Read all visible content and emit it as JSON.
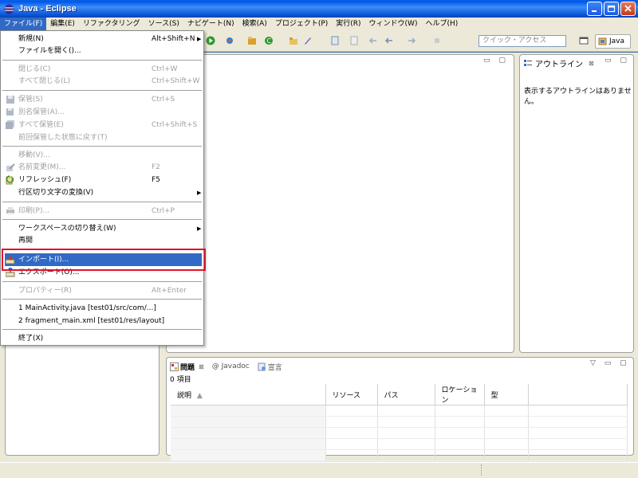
{
  "window": {
    "title": "Java - Eclipse"
  },
  "menubar": {
    "items": [
      {
        "label": "ファイル(F)"
      },
      {
        "label": "編集(E)"
      },
      {
        "label": "リファクタリング"
      },
      {
        "label": "ソース(S)"
      },
      {
        "label": "ナビゲート(N)"
      },
      {
        "label": "検索(A)"
      },
      {
        "label": "プロジェクト(P)"
      },
      {
        "label": "実行(R)"
      },
      {
        "label": "ウィンドウ(W)"
      },
      {
        "label": "ヘルプ(H)"
      }
    ]
  },
  "toolbar": {
    "quick_access_placeholder": "クイック・アクセス",
    "perspective_label": "Java"
  },
  "file_menu": {
    "items": [
      {
        "label": "新規(N)",
        "shortcut": "Alt+Shift+N",
        "submenu": true
      },
      {
        "label": "ファイルを開く()..."
      },
      {
        "label": "閉じる(C)",
        "shortcut": "Ctrl+W"
      },
      {
        "label": "すべて閉じる(L)",
        "shortcut": "Ctrl+Shift+W"
      },
      {
        "label": "保管(S)",
        "shortcut": "Ctrl+S"
      },
      {
        "label": "別名保管(A)..."
      },
      {
        "label": "すべて保管(E)",
        "shortcut": "Ctrl+Shift+S"
      },
      {
        "label": "前回保管した状態に戻す(T)"
      },
      {
        "label": "移動(V)..."
      },
      {
        "label": "名前変更(M)...",
        "shortcut": "F2"
      },
      {
        "label": "リフレッシュ(F)",
        "shortcut": "F5"
      },
      {
        "label": "行区切り文字の変換(V)",
        "submenu": true
      },
      {
        "label": "印刷(P)...",
        "shortcut": "Ctrl+P"
      },
      {
        "label": "ワークスペースの切り替え(W)",
        "submenu": true
      },
      {
        "label": "再開"
      },
      {
        "label": "インポート(I)..."
      },
      {
        "label": "エクスポート(O)..."
      },
      {
        "label": "プロパティー(R)",
        "shortcut": "Alt+Enter"
      },
      {
        "label": "1 MainActivity.java  [test01/src/com/...]"
      },
      {
        "label": "2 fragment_main.xml  [test01/res/layout]"
      },
      {
        "label": "終了(X)"
      }
    ]
  },
  "outline": {
    "tab_label": "アウトライン",
    "empty_message": "表示するアウトラインはありません。"
  },
  "problems": {
    "tabs": [
      {
        "label": "問題"
      },
      {
        "label": "@ Javadoc"
      },
      {
        "label": "宣言"
      }
    ],
    "count": "0 項目",
    "columns": [
      "説明",
      "リソース",
      "パス",
      "ロケーション",
      "型"
    ]
  },
  "colors": {
    "selection": "#316ac5",
    "highlight_box": "#e0142a",
    "titlebar": "#0058ee"
  }
}
